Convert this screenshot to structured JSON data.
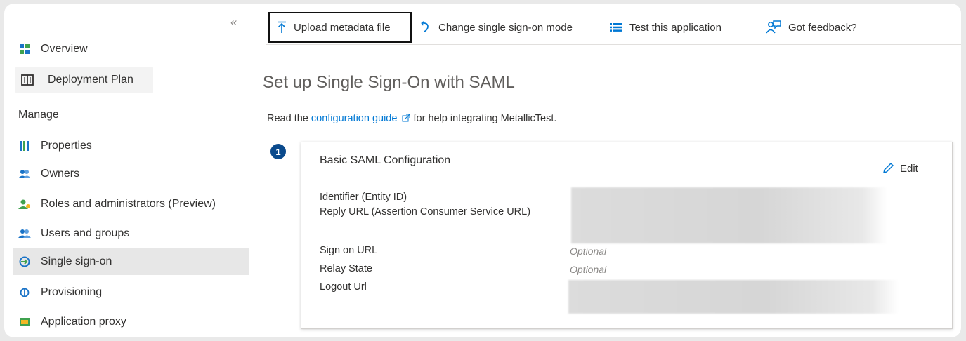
{
  "colors": {
    "accent": "#0078d4",
    "step_badge": "#0a4a8c",
    "active_nav_bg": "#e7e7e7",
    "upload_border": "#111111"
  },
  "sidebar": {
    "collapse_glyph": "«",
    "items": [
      {
        "label": "Overview",
        "icon": "overview-icon"
      },
      {
        "label": "Deployment Plan",
        "icon": "book-icon"
      },
      {
        "label": "Properties",
        "icon": "properties-icon"
      },
      {
        "label": "Owners",
        "icon": "owners-icon"
      },
      {
        "label": "Roles and administrators (Preview)",
        "icon": "roles-icon"
      },
      {
        "label": "Users and groups",
        "icon": "users-icon"
      },
      {
        "label": "Single sign-on",
        "icon": "sso-icon",
        "active": true
      },
      {
        "label": "Provisioning",
        "icon": "provisioning-icon"
      },
      {
        "label": "Application proxy",
        "icon": "app-proxy-icon"
      }
    ],
    "section_label": "Manage"
  },
  "toolbar": {
    "upload_label": "Upload metadata file",
    "change_label": "Change single sign-on mode",
    "test_label": "Test this application",
    "feedback_label": "Got feedback?"
  },
  "main": {
    "title": "Set up Single Sign-On with SAML",
    "guide_prefix": "Read the ",
    "guide_link": "configuration guide",
    "guide_suffix": " for help integrating MetallicTest."
  },
  "step": {
    "number": "1",
    "card_title": "Basic SAML Configuration",
    "edit_label": "Edit",
    "fields": {
      "identifier": "Identifier (Entity ID)",
      "reply_url": "Reply URL (Assertion Consumer Service URL)",
      "sign_on_url": "Sign on URL",
      "relay_state": "Relay State",
      "logout_url": "Logout Url"
    },
    "optional_text": "Optional"
  }
}
